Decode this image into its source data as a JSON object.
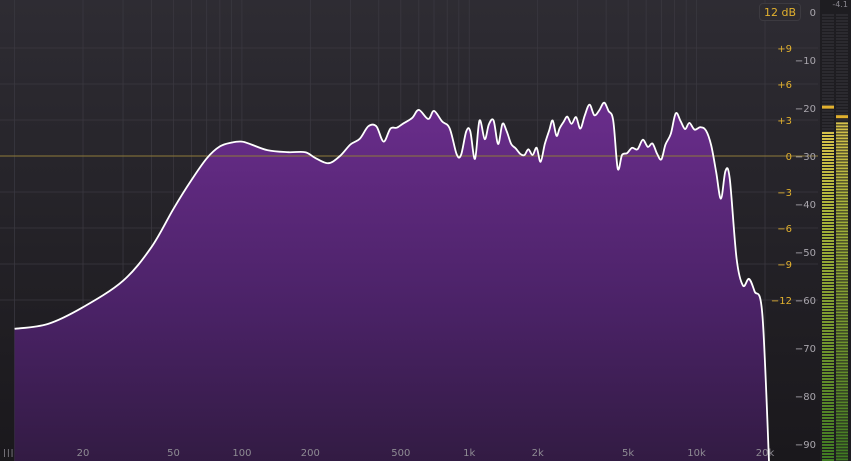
{
  "toolbar": {
    "range_label": "12 dB"
  },
  "meter": {
    "peak_readout": "-4.1",
    "peak_left_db": -19.5,
    "peak_right_db": -21.5,
    "level_left_db": -25,
    "level_right_db": -23
  },
  "icons": {
    "bottom_left": "grid-bars-icon"
  },
  "colors": {
    "fill": "#5a2a78",
    "curve": "#ffffff",
    "gain_label": "#e2b12e",
    "db_label": "#a9a6ad",
    "zero_line": "#8f7a3a"
  },
  "axis": {
    "freq_ticks": [
      {
        "value": 20,
        "label": "20"
      },
      {
        "value": 50,
        "label": "50"
      },
      {
        "value": 100,
        "label": "100"
      },
      {
        "value": 200,
        "label": "200"
      },
      {
        "value": 500,
        "label": "500"
      },
      {
        "value": 1000,
        "label": "1k"
      },
      {
        "value": 2000,
        "label": "2k"
      },
      {
        "value": 5000,
        "label": "5k"
      },
      {
        "value": 10000,
        "label": "10k"
      },
      {
        "value": 20000,
        "label": "20k"
      }
    ],
    "gain_ticks": [
      {
        "value": 9,
        "label": "+9"
      },
      {
        "value": 6,
        "label": "+6"
      },
      {
        "value": 3,
        "label": "+3"
      },
      {
        "value": 0,
        "label": "0"
      },
      {
        "value": -3,
        "label": "-3"
      },
      {
        "value": -6,
        "label": "-6"
      },
      {
        "value": -9,
        "label": "-9"
      },
      {
        "value": -12,
        "label": "-12"
      }
    ],
    "db_ticks": [
      {
        "value": 0,
        "label": "0"
      },
      {
        "value": -10,
        "label": "-10"
      },
      {
        "value": -20,
        "label": "-20"
      },
      {
        "value": -30,
        "label": "-30"
      },
      {
        "value": -40,
        "label": "-40"
      },
      {
        "value": -50,
        "label": "-50"
      },
      {
        "value": -60,
        "label": "-60"
      },
      {
        "value": -70,
        "label": "-70"
      },
      {
        "value": -80,
        "label": "-80"
      },
      {
        "value": -90,
        "label": "-90"
      }
    ]
  },
  "spectrum": [
    [
      10,
      -66
    ],
    [
      14,
      -65
    ],
    [
      20,
      -61.5
    ],
    [
      30,
      -56
    ],
    [
      40,
      -49
    ],
    [
      50,
      -41
    ],
    [
      60,
      -35
    ],
    [
      70,
      -30.5
    ],
    [
      80,
      -28
    ],
    [
      90,
      -27.2
    ],
    [
      100,
      -27
    ],
    [
      110,
      -27.6
    ],
    [
      130,
      -28.8
    ],
    [
      160,
      -29.2
    ],
    [
      190,
      -29.2
    ],
    [
      210,
      -30.4
    ],
    [
      240,
      -31.5
    ],
    [
      270,
      -30
    ],
    [
      300,
      -27.6
    ],
    [
      330,
      -26.4
    ],
    [
      360,
      -23.8
    ],
    [
      390,
      -23.8
    ],
    [
      420,
      -27
    ],
    [
      450,
      -24.3
    ],
    [
      480,
      -24.1
    ],
    [
      510,
      -23.3
    ],
    [
      560,
      -22.1
    ],
    [
      600,
      -20.4
    ],
    [
      660,
      -22.3
    ],
    [
      700,
      -20.6
    ],
    [
      760,
      -22.8
    ],
    [
      820,
      -24.2
    ],
    [
      880,
      -29.6
    ],
    [
      920,
      -29.8
    ],
    [
      970,
      -24.9
    ],
    [
      1010,
      -24.8
    ],
    [
      1060,
      -30.6
    ],
    [
      1110,
      -22.6
    ],
    [
      1170,
      -26.5
    ],
    [
      1220,
      -23.4
    ],
    [
      1280,
      -22.6
    ],
    [
      1340,
      -27.5
    ],
    [
      1400,
      -23.3
    ],
    [
      1460,
      -24.8
    ],
    [
      1530,
      -27.5
    ],
    [
      1600,
      -28.4
    ],
    [
      1680,
      -29.6
    ],
    [
      1750,
      -29.8
    ],
    [
      1820,
      -28.6
    ],
    [
      1900,
      -29.8
    ],
    [
      1980,
      -28.3
    ],
    [
      2060,
      -31.2
    ],
    [
      2150,
      -27.5
    ],
    [
      2250,
      -24.6
    ],
    [
      2330,
      -22.6
    ],
    [
      2420,
      -25.8
    ],
    [
      2500,
      -24.2
    ],
    [
      2600,
      -22.9
    ],
    [
      2700,
      -21.8
    ],
    [
      2820,
      -23.3
    ],
    [
      2950,
      -21.9
    ],
    [
      3080,
      -24.3
    ],
    [
      3220,
      -21.6
    ],
    [
      3380,
      -19.3
    ],
    [
      3550,
      -21.5
    ],
    [
      3730,
      -20.5
    ],
    [
      3920,
      -18.9
    ],
    [
      4100,
      -20.6
    ],
    [
      4300,
      -22.6
    ],
    [
      4500,
      -32.6
    ],
    [
      4700,
      -29.8
    ],
    [
      4950,
      -29.4
    ],
    [
      5200,
      -28.3
    ],
    [
      5500,
      -28.6
    ],
    [
      5800,
      -26.6
    ],
    [
      6100,
      -28.1
    ],
    [
      6400,
      -27.4
    ],
    [
      6700,
      -29.5
    ],
    [
      7000,
      -30.7
    ],
    [
      7300,
      -27.6
    ],
    [
      7700,
      -25.4
    ],
    [
      8100,
      -21.1
    ],
    [
      8500,
      -22.7
    ],
    [
      8900,
      -24.4
    ],
    [
      9300,
      -23.1
    ],
    [
      9800,
      -24.5
    ],
    [
      10400,
      -24
    ],
    [
      11000,
      -24.7
    ],
    [
      11600,
      -27.8
    ],
    [
      12200,
      -33.4
    ],
    [
      12800,
      -38.9
    ],
    [
      13400,
      -33.1
    ],
    [
      14000,
      -34.8
    ],
    [
      15000,
      -51.4
    ],
    [
      16000,
      -57
    ],
    [
      17000,
      -55.6
    ],
    [
      18000,
      -58.2
    ],
    [
      19500,
      -63.4
    ],
    [
      21000,
      -98
    ]
  ]
}
